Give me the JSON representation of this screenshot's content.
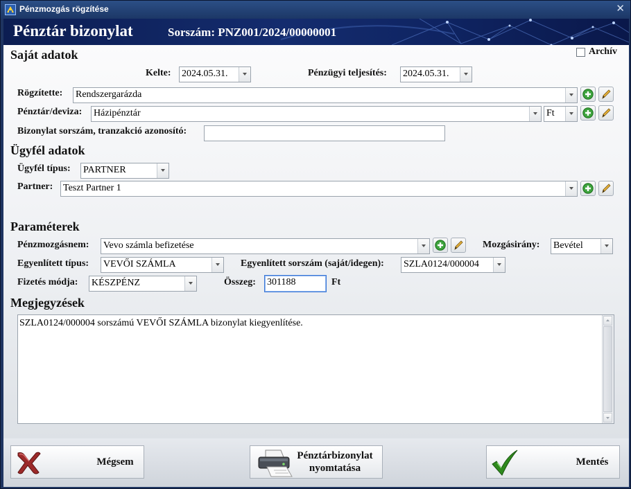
{
  "window": {
    "title": "Pénzmozgás rögzítése"
  },
  "banner": {
    "title": "Pénztár bizonylat",
    "serial_label": "Sorszám: PNZ001/2024/00000001"
  },
  "own": {
    "section": "Saját adatok",
    "archive_label": "Archív",
    "date_label": "Kelte:",
    "date_value": "2024.05.31.",
    "settlement_label": "Pénzügyi teljesítés:",
    "settlement_value": "2024.05.31.",
    "recorder_label": "Rögzítette:",
    "recorder_value": "Rendszergarázda",
    "cashbox_label": "Pénztár/deviza:",
    "cashbox_value": "Házipénztár",
    "currency_value": "Ft",
    "docnum_label": "Bizonylat sorszám, tranzakció azonosító:",
    "docnum_value": ""
  },
  "client": {
    "section": "Ügyfél adatok",
    "type_label": "Ügyfél típus:",
    "type_value": "PARTNER",
    "partner_label": "Partner:",
    "partner_value": "Teszt Partner 1"
  },
  "params": {
    "section": "Paraméterek",
    "movement_label": "Pénzmozgásnem:",
    "movement_value": "Vevo számla befizetése",
    "direction_label": "Mozgásirány:",
    "direction_value": "Bevétel",
    "settled_type_label": "Egyenlített típus:",
    "settled_type_value": "VEVŐI SZÁMLA",
    "settled_num_label": "Egyenlített sorszám (saját/idegen):",
    "settled_num_value": "SZLA0124/000004",
    "payment_label": "Fizetés módja:",
    "payment_value": "KÉSZPÉNZ",
    "amount_label": "Összeg:",
    "amount_value": "301188",
    "amount_unit": "Ft"
  },
  "notes": {
    "section": "Megjegyzések",
    "text": "SZLA0124/000004 sorszámú VEVŐI SZÁMLA bizonylat kiegyenlítése."
  },
  "footer": {
    "cancel_label": "Mégsem",
    "print_label_1": "Pénztárbizonylat",
    "print_label_2": "nyomtatása",
    "save_label": "Mentés"
  },
  "icons": {
    "app": "app-icon",
    "close": "close-icon",
    "add": "add-icon",
    "edit": "edit-pencil-icon",
    "cancel": "cancel-x-icon",
    "print": "printer-icon",
    "save": "checkmark-icon"
  }
}
